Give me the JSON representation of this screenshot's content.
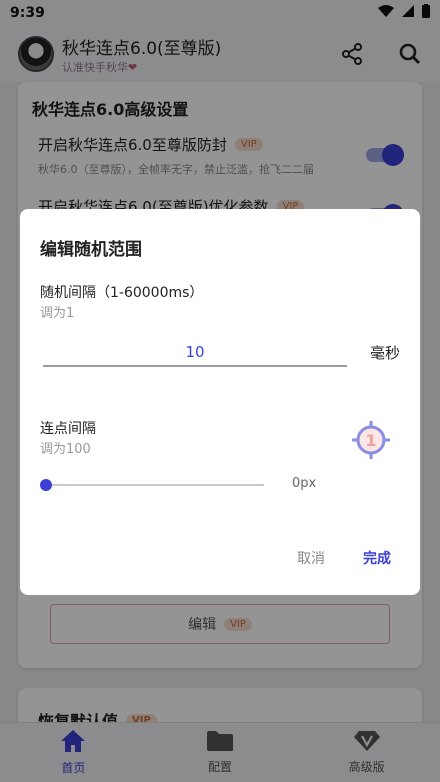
{
  "status": {
    "time": "9:39"
  },
  "app": {
    "title": "秋华连点6.0(至尊版)",
    "subtitle": "认准快手秋华"
  },
  "card": {
    "title": "秋华连点6.0高级设置",
    "option1_title": "开启秋华连点6.0至尊版防封",
    "option1_desc": "秋华6.0（至尊版），全帧率无字，禁止泛滥，抢飞二二届",
    "option2_title": "开启秋华连点6.0(至尊版)优化参数",
    "vip": "VIP",
    "edit_label": "编辑"
  },
  "card2": {
    "title": "恢复默认值"
  },
  "dialog": {
    "title": "编辑随机范围",
    "interval_label": "随机间隔（1-60000ms）",
    "interval_hint": "调为1",
    "interval_value": "10",
    "interval_unit": "毫秒",
    "click_interval_label": "连点间隔",
    "click_interval_hint": "调为100",
    "target_number": "1",
    "slider_value_label": "0px",
    "slider_fraction": 0,
    "cancel_label": "取消",
    "confirm_label": "完成"
  },
  "nav": {
    "home": "首页",
    "config": "配置",
    "premium": "高级版"
  },
  "colors": {
    "accent": "#3b3fd6",
    "vip_bg": "#f5dccd",
    "vip_text": "#c46a3f"
  }
}
